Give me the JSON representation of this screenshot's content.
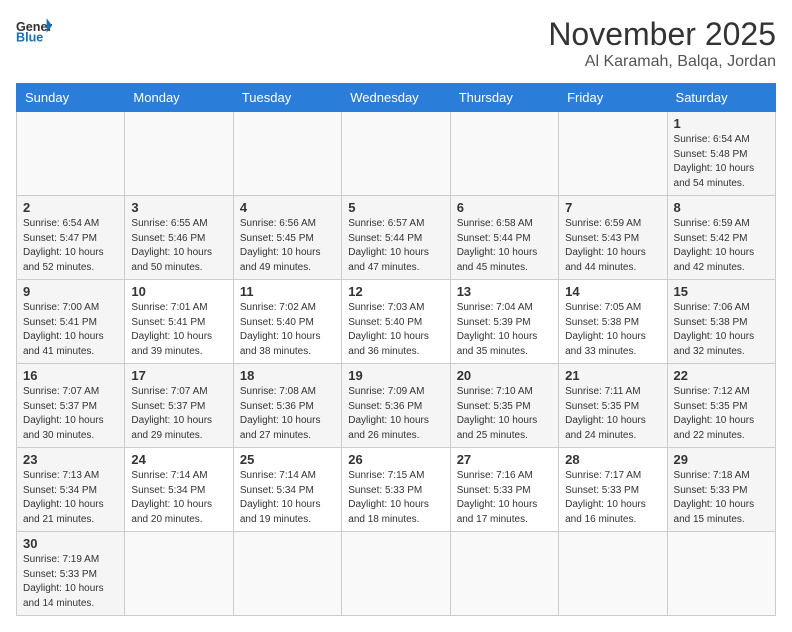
{
  "header": {
    "logo_general": "General",
    "logo_blue": "Blue",
    "title": "November 2025",
    "location": "Al Karamah, Balqa, Jordan"
  },
  "weekdays": [
    "Sunday",
    "Monday",
    "Tuesday",
    "Wednesday",
    "Thursday",
    "Friday",
    "Saturday"
  ],
  "weeks": [
    [
      {
        "day": "",
        "info": ""
      },
      {
        "day": "",
        "info": ""
      },
      {
        "day": "",
        "info": ""
      },
      {
        "day": "",
        "info": ""
      },
      {
        "day": "",
        "info": ""
      },
      {
        "day": "",
        "info": ""
      },
      {
        "day": "1",
        "info": "Sunrise: 6:54 AM\nSunset: 5:48 PM\nDaylight: 10 hours\nand 54 minutes."
      }
    ],
    [
      {
        "day": "2",
        "info": "Sunrise: 6:54 AM\nSunset: 5:47 PM\nDaylight: 10 hours\nand 52 minutes."
      },
      {
        "day": "3",
        "info": "Sunrise: 6:55 AM\nSunset: 5:46 PM\nDaylight: 10 hours\nand 50 minutes."
      },
      {
        "day": "4",
        "info": "Sunrise: 6:56 AM\nSunset: 5:45 PM\nDaylight: 10 hours\nand 49 minutes."
      },
      {
        "day": "5",
        "info": "Sunrise: 6:57 AM\nSunset: 5:44 PM\nDaylight: 10 hours\nand 47 minutes."
      },
      {
        "day": "6",
        "info": "Sunrise: 6:58 AM\nSunset: 5:44 PM\nDaylight: 10 hours\nand 45 minutes."
      },
      {
        "day": "7",
        "info": "Sunrise: 6:59 AM\nSunset: 5:43 PM\nDaylight: 10 hours\nand 44 minutes."
      },
      {
        "day": "8",
        "info": "Sunrise: 6:59 AM\nSunset: 5:42 PM\nDaylight: 10 hours\nand 42 minutes."
      }
    ],
    [
      {
        "day": "9",
        "info": "Sunrise: 7:00 AM\nSunset: 5:41 PM\nDaylight: 10 hours\nand 41 minutes."
      },
      {
        "day": "10",
        "info": "Sunrise: 7:01 AM\nSunset: 5:41 PM\nDaylight: 10 hours\nand 39 minutes."
      },
      {
        "day": "11",
        "info": "Sunrise: 7:02 AM\nSunset: 5:40 PM\nDaylight: 10 hours\nand 38 minutes."
      },
      {
        "day": "12",
        "info": "Sunrise: 7:03 AM\nSunset: 5:40 PM\nDaylight: 10 hours\nand 36 minutes."
      },
      {
        "day": "13",
        "info": "Sunrise: 7:04 AM\nSunset: 5:39 PM\nDaylight: 10 hours\nand 35 minutes."
      },
      {
        "day": "14",
        "info": "Sunrise: 7:05 AM\nSunset: 5:38 PM\nDaylight: 10 hours\nand 33 minutes."
      },
      {
        "day": "15",
        "info": "Sunrise: 7:06 AM\nSunset: 5:38 PM\nDaylight: 10 hours\nand 32 minutes."
      }
    ],
    [
      {
        "day": "16",
        "info": "Sunrise: 7:07 AM\nSunset: 5:37 PM\nDaylight: 10 hours\nand 30 minutes."
      },
      {
        "day": "17",
        "info": "Sunrise: 7:07 AM\nSunset: 5:37 PM\nDaylight: 10 hours\nand 29 minutes."
      },
      {
        "day": "18",
        "info": "Sunrise: 7:08 AM\nSunset: 5:36 PM\nDaylight: 10 hours\nand 27 minutes."
      },
      {
        "day": "19",
        "info": "Sunrise: 7:09 AM\nSunset: 5:36 PM\nDaylight: 10 hours\nand 26 minutes."
      },
      {
        "day": "20",
        "info": "Sunrise: 7:10 AM\nSunset: 5:35 PM\nDaylight: 10 hours\nand 25 minutes."
      },
      {
        "day": "21",
        "info": "Sunrise: 7:11 AM\nSunset: 5:35 PM\nDaylight: 10 hours\nand 24 minutes."
      },
      {
        "day": "22",
        "info": "Sunrise: 7:12 AM\nSunset: 5:35 PM\nDaylight: 10 hours\nand 22 minutes."
      }
    ],
    [
      {
        "day": "23",
        "info": "Sunrise: 7:13 AM\nSunset: 5:34 PM\nDaylight: 10 hours\nand 21 minutes."
      },
      {
        "day": "24",
        "info": "Sunrise: 7:14 AM\nSunset: 5:34 PM\nDaylight: 10 hours\nand 20 minutes."
      },
      {
        "day": "25",
        "info": "Sunrise: 7:14 AM\nSunset: 5:34 PM\nDaylight: 10 hours\nand 19 minutes."
      },
      {
        "day": "26",
        "info": "Sunrise: 7:15 AM\nSunset: 5:33 PM\nDaylight: 10 hours\nand 18 minutes."
      },
      {
        "day": "27",
        "info": "Sunrise: 7:16 AM\nSunset: 5:33 PM\nDaylight: 10 hours\nand 17 minutes."
      },
      {
        "day": "28",
        "info": "Sunrise: 7:17 AM\nSunset: 5:33 PM\nDaylight: 10 hours\nand 16 minutes."
      },
      {
        "day": "29",
        "info": "Sunrise: 7:18 AM\nSunset: 5:33 PM\nDaylight: 10 hours\nand 15 minutes."
      }
    ],
    [
      {
        "day": "30",
        "info": "Sunrise: 7:19 AM\nSunset: 5:33 PM\nDaylight: 10 hours\nand 14 minutes."
      },
      {
        "day": "",
        "info": ""
      },
      {
        "day": "",
        "info": ""
      },
      {
        "day": "",
        "info": ""
      },
      {
        "day": "",
        "info": ""
      },
      {
        "day": "",
        "info": ""
      },
      {
        "day": "",
        "info": ""
      }
    ]
  ]
}
